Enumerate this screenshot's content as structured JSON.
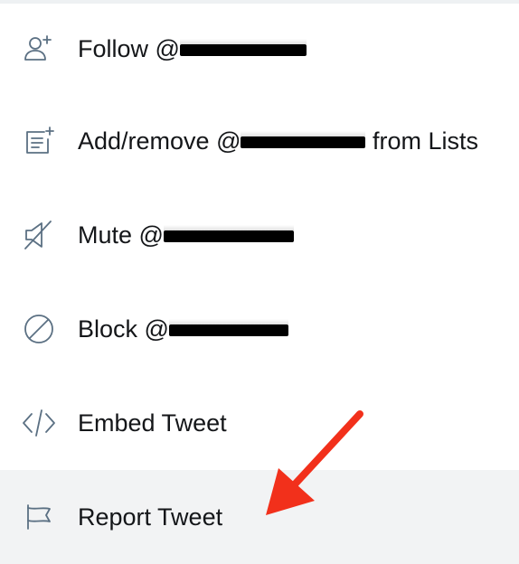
{
  "menu": {
    "items": [
      {
        "id": "follow",
        "icon": "add-user-icon",
        "label_prefix": "Follow @",
        "label_suffix": ""
      },
      {
        "id": "lists",
        "icon": "add-to-list-icon",
        "label_prefix": "Add/remove @",
        "label_suffix": " from Lists"
      },
      {
        "id": "mute",
        "icon": "mute-icon",
        "label_prefix": "Mute @",
        "label_suffix": ""
      },
      {
        "id": "block",
        "icon": "block-icon",
        "label_prefix": "Block @",
        "label_suffix": ""
      },
      {
        "id": "embed",
        "icon": "code-icon",
        "label_prefix": "Embed Tweet",
        "label_suffix": ""
      },
      {
        "id": "report",
        "icon": "flag-icon",
        "label_prefix": "Report Tweet",
        "label_suffix": ""
      }
    ],
    "highlighted_item": "report"
  },
  "annotation": {
    "arrow_color": "#f2301b",
    "icon_color": "#5b7083",
    "text_color": "#141619"
  }
}
